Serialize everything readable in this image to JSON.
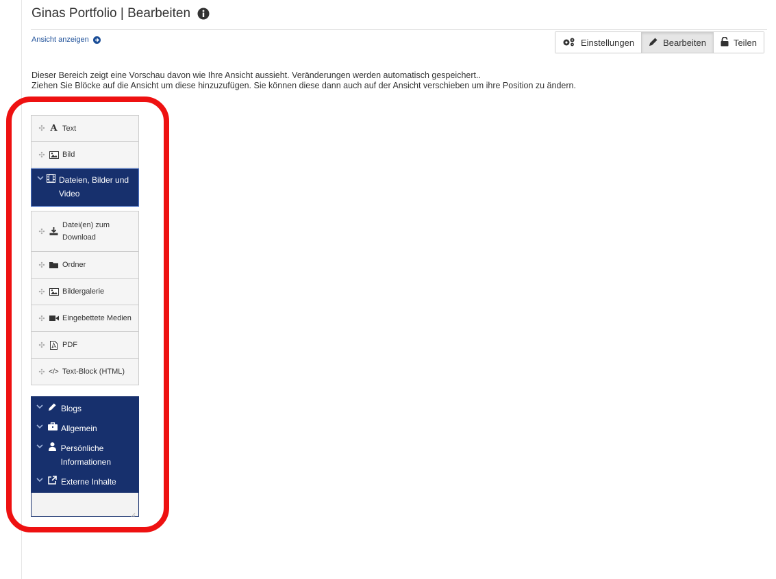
{
  "header": {
    "title": "Ginas Portfolio | Bearbeiten",
    "view_link": "Ansicht anzeigen"
  },
  "toolbar": {
    "settings_label": "Einstellungen",
    "edit_label": "Bearbeiten",
    "share_label": "Teilen",
    "active": "Bearbeiten"
  },
  "description": {
    "line1": "Dieser Bereich zeigt eine Vorschau davon wie Ihre Ansicht aussieht. Veränderungen werden automatisch gespeichert..",
    "line2": "Ziehen Sie Blöcke auf die Ansicht um diese hinzuzufügen. Sie können diese dann auch auf der Ansicht verschieben um ihre Position zu ändern."
  },
  "blocks": {
    "top_items": [
      {
        "label": "Text",
        "icon": "text-icon"
      },
      {
        "label": "Bild",
        "icon": "image-icon"
      }
    ],
    "open_category": {
      "label": "Dateien, Bilder und Video",
      "icon": "film-icon",
      "state": "expanded"
    },
    "sub_items": [
      {
        "label": "Datei(en) zum Download",
        "icon": "download-icon"
      },
      {
        "label": "Ordner",
        "icon": "folder-icon"
      },
      {
        "label": "Bildergalerie",
        "icon": "image-icon"
      },
      {
        "label": "Eingebettete Medien",
        "icon": "video-camera-icon"
      },
      {
        "label": "PDF",
        "icon": "pdf-icon"
      },
      {
        "label": "Text-Block (HTML)",
        "icon": "code-icon"
      }
    ],
    "collapsed_categories": [
      {
        "label": "Blogs",
        "icon": "pencil-icon"
      },
      {
        "label": "Allgemein",
        "icon": "briefcase-icon"
      },
      {
        "label": "Persönliche Informationen",
        "icon": "user-icon"
      },
      {
        "label": "Externe Inhalte",
        "icon": "external-link-icon"
      }
    ]
  },
  "colors": {
    "category_bg": "#17306d",
    "link": "#1a4d97",
    "highlight": "#ee1111"
  }
}
